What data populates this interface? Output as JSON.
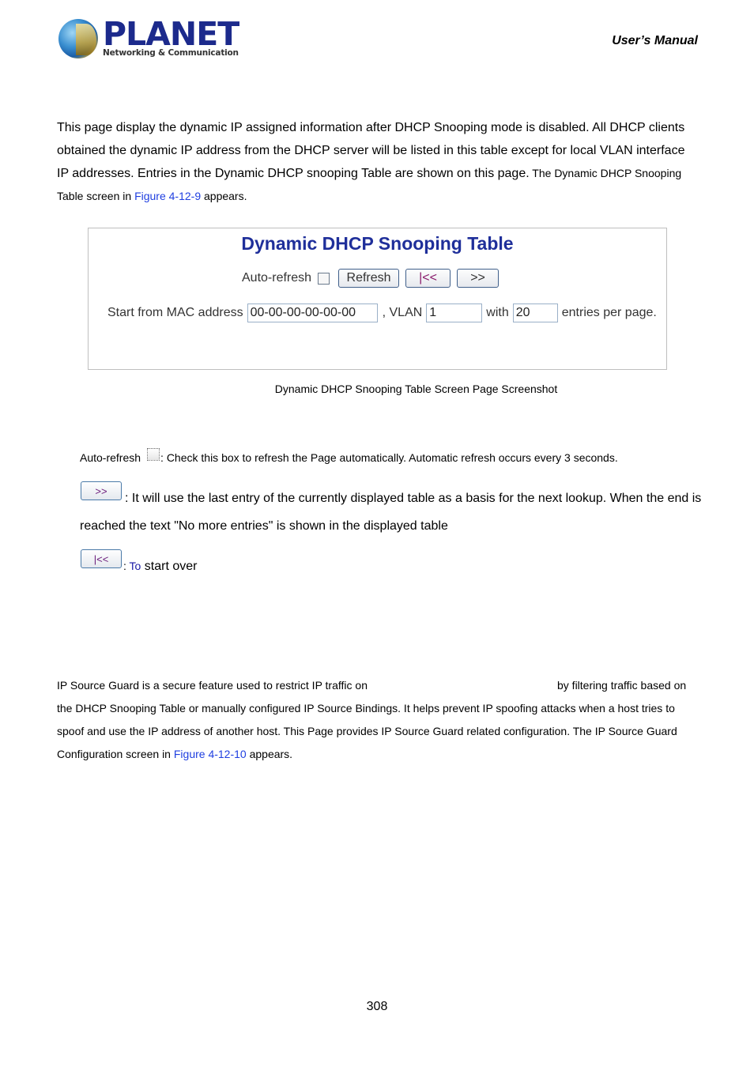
{
  "header": {
    "logo": {
      "name": "PLANET",
      "tagline": "Networking & Communication"
    },
    "manual_title": "User’s  Manual"
  },
  "intro": {
    "text_main": "This page display the dynamic IP assigned information after DHCP Snooping mode is disabled. All DHCP clients obtained the dynamic IP address from the DHCP server will be listed in this table except for local VLAN interface IP addresses. Entries in the Dynamic DHCP snooping Table are shown on this page.",
    "text_small_pre": " The Dynamic DHCP Snooping Table screen in ",
    "figure_link": "Figure 4-12-9",
    "text_small_post": " appears."
  },
  "figure": {
    "title": "Dynamic DHCP Snooping Table",
    "auto_refresh_label": "Auto-refresh",
    "auto_refresh_checked": false,
    "refresh_button": "Refresh",
    "first_page_button": "|<<",
    "next_page_button": ">>",
    "start_mac_label": "Start from MAC address",
    "start_mac_value": "00-00-00-00-00-00",
    "vlan_label": ", VLAN",
    "vlan_value": "1",
    "with_label": "with",
    "entries_value": "20",
    "entries_label": "entries per page.",
    "caption": "Dynamic DHCP Snooping Table Screen Page Screenshot"
  },
  "descriptions": {
    "auto_refresh": {
      "label": "Auto-refresh",
      "text": ": Check this box to refresh the Page automatically. Automatic refresh occurs every 3 seconds."
    },
    "next": {
      "button": ">>",
      "text_line1": ": It will use the last entry of the currently displayed table as a basis for the next lookup. When the end is",
      "text_line2": "reached the text \"No more entries\" is shown in the displayed table"
    },
    "first": {
      "button": "|<<",
      "text_link": "To",
      "text_rest": " start over",
      "colon": ": "
    }
  },
  "ip_source_guard": {
    "line1_a": "IP Source Guard is a secure feature used to restrict IP traffic on",
    "line1_b": "by filtering traffic based on",
    "line2": "the DHCP Snooping Table or manually configured IP Source Bindings. It helps prevent IP spoofing attacks when a host tries to",
    "line3": "spoof and use the IP address of another host. This Page provides IP Source Guard related configuration. The IP Source Guard",
    "line4_pre": "Configuration screen in ",
    "figure_link": "Figure 4-12-10",
    "line4_post": " appears."
  },
  "footer": {
    "page_number": "308"
  }
}
